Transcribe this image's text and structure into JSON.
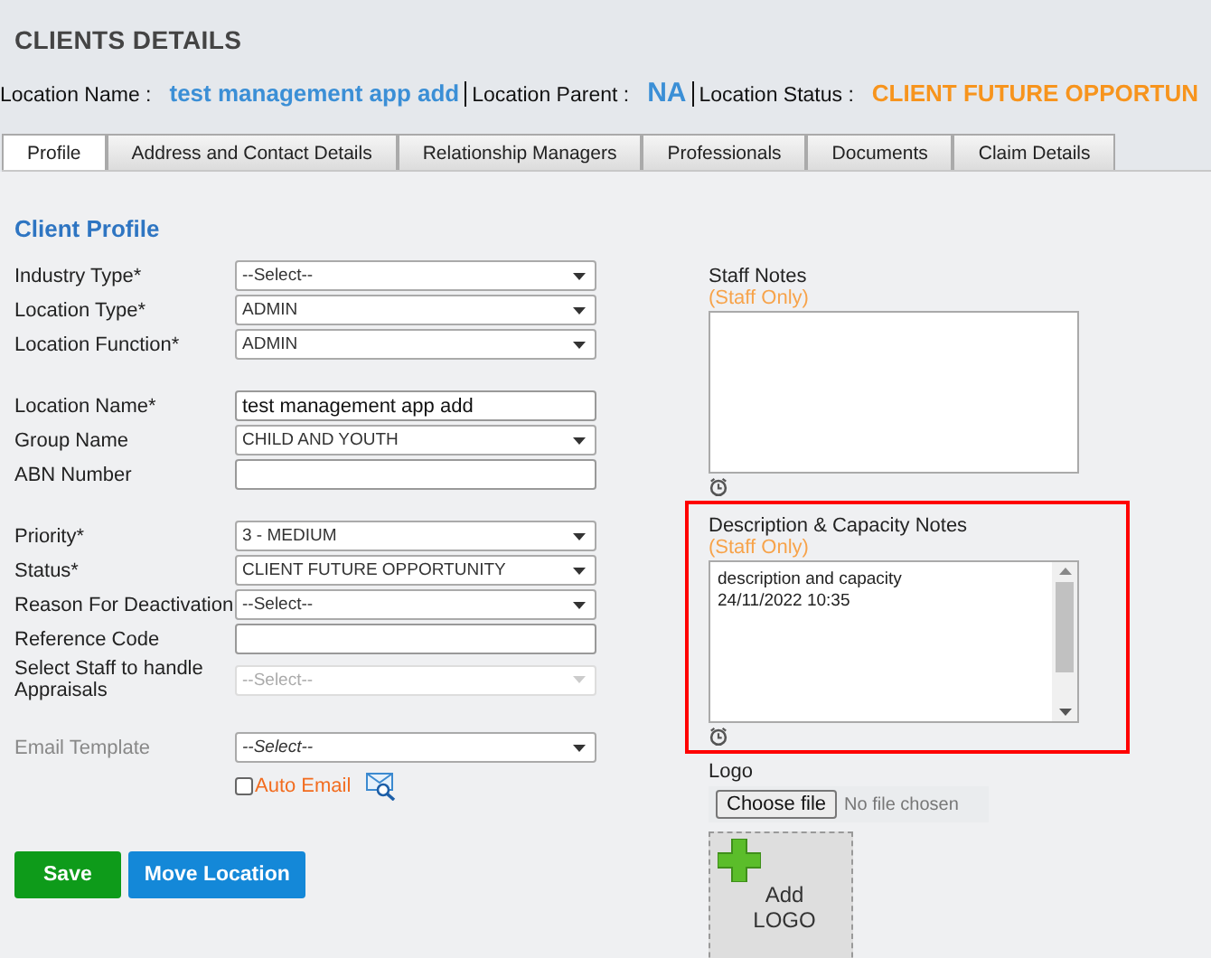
{
  "page_title": "CLIENTS DETAILS",
  "info": [
    {
      "label": "Location Name :",
      "value": "test management app add",
      "color": "#3b8fd6"
    },
    {
      "label": "Location Parent :",
      "value": "NA",
      "color": "#3b8fd6"
    },
    {
      "label": "Location Status :",
      "value": "CLIENT FUTURE OPPORTUN",
      "color": "#f7941d"
    }
  ],
  "tabs": [
    {
      "label": "Profile",
      "selected": true
    },
    {
      "label": "Address and Contact Details",
      "selected": false
    },
    {
      "label": "Relationship Managers",
      "selected": false
    },
    {
      "label": "Professionals",
      "selected": false
    },
    {
      "label": "Documents",
      "selected": false
    },
    {
      "label": "Claim Details",
      "selected": false
    }
  ],
  "section_title": "Client Profile",
  "field_groups": [
    [
      {
        "label": "Industry Type*",
        "kind": "select",
        "value": "--Select--",
        "disabled": false
      },
      {
        "label": "Location Type*",
        "kind": "select",
        "value": "ADMIN",
        "disabled": false
      },
      {
        "label": "Location Function*",
        "kind": "select",
        "value": "ADMIN",
        "disabled": false
      }
    ],
    [
      {
        "label": "Location Name*",
        "kind": "text",
        "value": "test management app add",
        "disabled": false
      },
      {
        "label": "Group Name",
        "kind": "select",
        "value": "CHILD AND YOUTH",
        "disabled": false
      },
      {
        "label": "ABN Number",
        "kind": "text",
        "disabled": false
      }
    ],
    [
      {
        "label": "Priority*",
        "kind": "select",
        "value": "3 - MEDIUM",
        "disabled": false
      },
      {
        "label": "Status*",
        "kind": "select",
        "value": "CLIENT FUTURE OPPORTUNITY",
        "disabled": false
      },
      {
        "label": "Reason For Deactivation",
        "kind": "select",
        "value": "--Select--",
        "disabled": false
      },
      {
        "label": "Reference Code",
        "kind": "text",
        "disabled": false
      },
      {
        "label": "Select Staff to handle Appraisals",
        "kind": "select",
        "value": "--Select--",
        "disabled": true
      }
    ],
    [
      {
        "label": "Email Template",
        "kind": "select",
        "value": "--Select--",
        "disabled": false,
        "label_muted": true
      }
    ]
  ],
  "auto_email": {
    "label": "Auto Email",
    "checked": false
  },
  "buttons": [
    {
      "label": "Save",
      "kind": "save"
    },
    {
      "label": "Move Location",
      "kind": "move"
    }
  ],
  "notes": [
    {
      "title": "Staff Notes",
      "note": "(Staff Only)",
      "highlighted": false,
      "scrollbar": false
    },
    {
      "title": "Description & Capacity Notes",
      "note": "(Staff Only)",
      "lines": [
        "description and capacity",
        "24/11/2022 10:35"
      ],
      "highlighted": true,
      "scrollbar": true
    }
  ],
  "logo": {
    "label": "Logo",
    "button": "Choose file",
    "status": "No file chosen",
    "add_label": [
      "Add",
      "LOGO"
    ]
  }
}
